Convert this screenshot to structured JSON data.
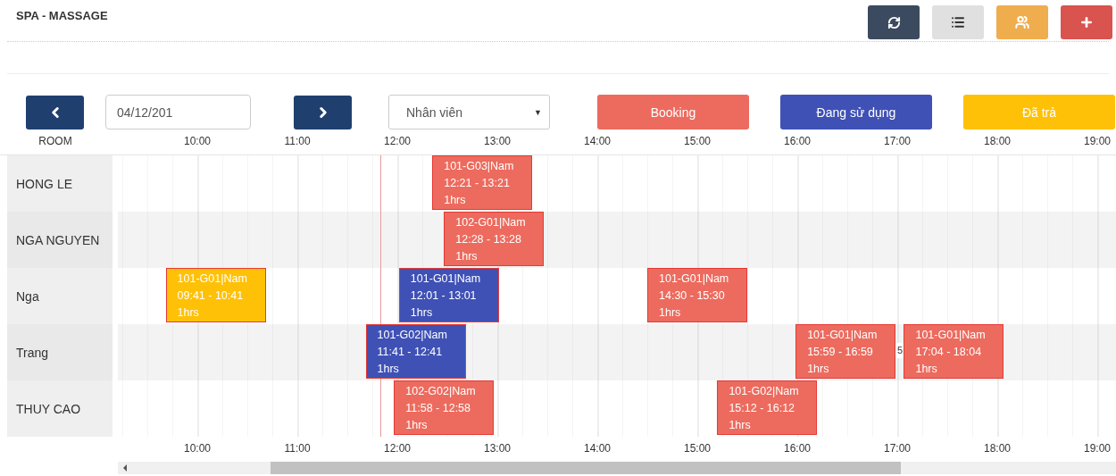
{
  "page_title": "SPA - MASSAGE",
  "toolbar": {
    "date": "04/12/201",
    "staff_select": "Nhân viên",
    "select_arrow": "▼",
    "room_label": "ROOM"
  },
  "legend": [
    {
      "label": "Booking",
      "color": "#ec6b5e"
    },
    {
      "label": "Đang sử dụng",
      "color": "#3f51b5"
    },
    {
      "label": "Đã trả",
      "color": "#ffc107"
    }
  ],
  "hours_top": [
    "10:00",
    "11:00",
    "12:00",
    "13:00",
    "14:00",
    "15:00",
    "16:00",
    "17:00",
    "18:00",
    "19:00"
  ],
  "current_time_marker": {
    "level": 0.263
  },
  "rooms": [
    {
      "name": "HONG LE",
      "events": [
        {
          "code": "101-G03|Nam",
          "time": "12:21 - 13:21",
          "duration": "1hrs",
          "color": "#ec6b5e"
        }
      ]
    },
    {
      "name": "NGA NGUYEN",
      "events": [
        {
          "code": "102-G01|Nam",
          "time": "12:28 - 13:28",
          "duration": "1hrs",
          "color": "#ec6b5e"
        }
      ]
    },
    {
      "name": "Nga",
      "events": [
        {
          "code": "101-G01|Nam",
          "time": "09:41 - 10:41",
          "duration": "1hrs",
          "color": "#ffc107"
        },
        {
          "code": "101-G01|Nam",
          "time": "12:01 - 13:01",
          "duration": "1hrs",
          "color": "#3f51b5"
        },
        {
          "code": "101-G01|Nam",
          "time": "14:30 - 15:30",
          "duration": "1hrs",
          "color": "#ec6b5e"
        }
      ]
    },
    {
      "name": "Trang",
      "events": [
        {
          "code": "101-G02|Nam",
          "time": "11:41 - 12:41",
          "duration": "1hrs",
          "color": "#3f51b5"
        },
        {
          "code": "101-G01|Nam",
          "time": "15:59 - 16:59",
          "duration": "1hrs",
          "color": "#ec6b5e",
          "gap_after": "5"
        },
        {
          "code": "101-G01|Nam",
          "time": "17:04 - 18:04",
          "duration": "1hrs",
          "color": "#ec6b5e"
        }
      ]
    },
    {
      "name": "THUY CAO",
      "events": [
        {
          "code": "102-G02|Nam",
          "time": "11:58 - 12:58",
          "duration": "1hrs",
          "color": "#ec6b5e"
        },
        {
          "code": "101-G02|Nam",
          "time": "15:12 - 16:12",
          "duration": "1hrs",
          "color": "#ec6b5e"
        }
      ]
    }
  ],
  "hours_bottom": [
    "10:00",
    "11:00",
    "12:00",
    "13:00",
    "14:00",
    "15:00",
    "16:00",
    "17:00",
    "18:00",
    "19:00"
  ]
}
